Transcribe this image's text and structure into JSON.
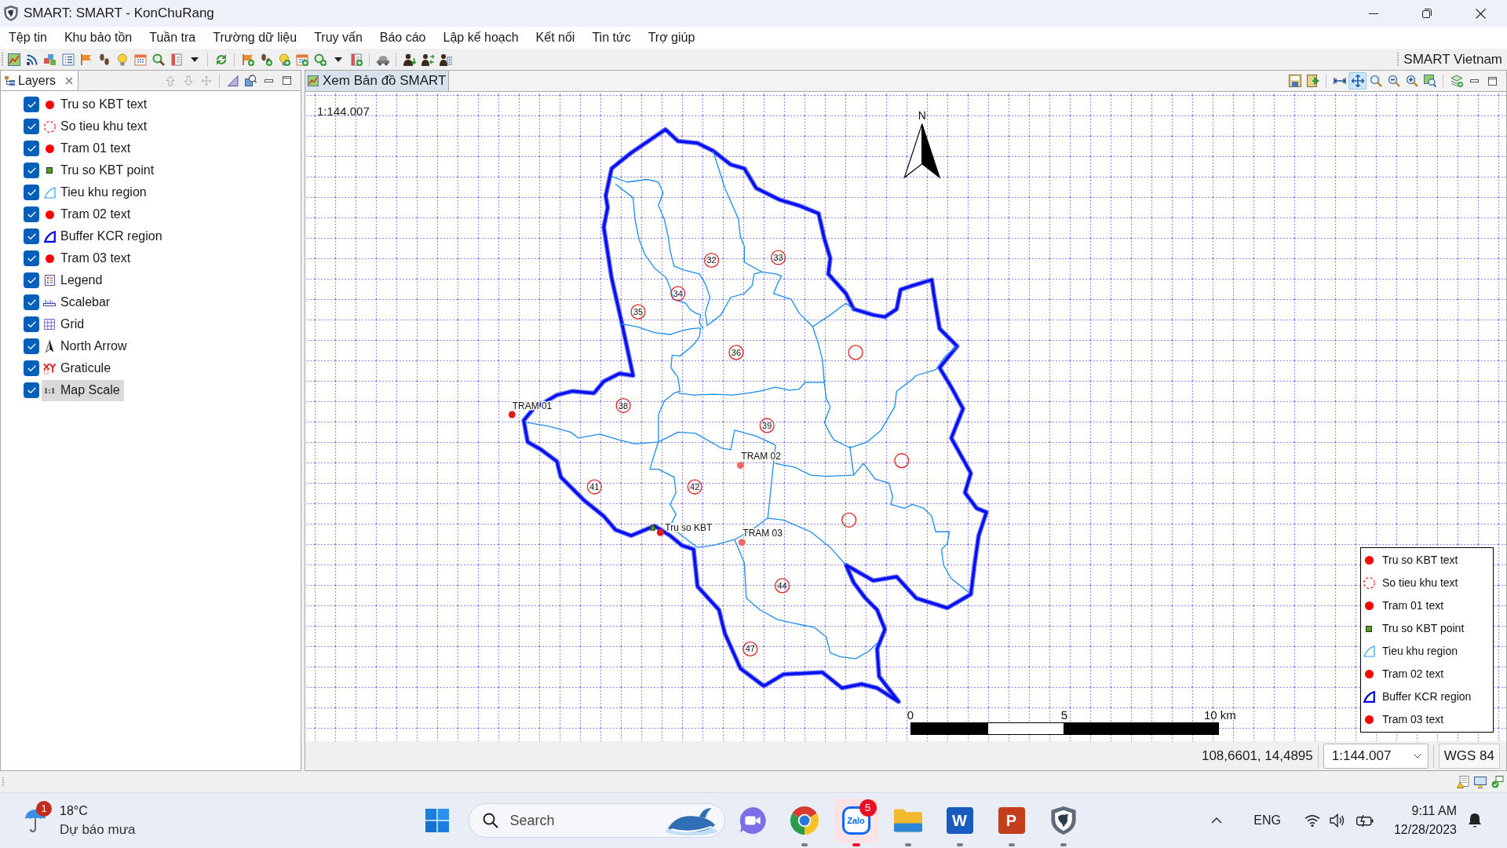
{
  "window": {
    "title": "SMART: SMART - KonChuRang"
  },
  "menu": [
    "Tệp tin",
    "Khu bảo tồn",
    "Tuần tra",
    "Trường dữ liệu",
    "Truy vấn",
    "Báo cáo",
    "Lập kế hoạch",
    "Kết nối",
    "Tin tức",
    "Trợ giúp"
  ],
  "toolbar": {
    "brand": "SMART Vietnam"
  },
  "layers_panel": {
    "title": "Layers",
    "items": [
      {
        "label": "Tru so KBT text",
        "kind": "dot",
        "checked": true,
        "selected": false
      },
      {
        "label": "So tieu khu text",
        "kind": "ring",
        "checked": true,
        "selected": false
      },
      {
        "label": "Tram 01 text",
        "kind": "dot",
        "checked": true,
        "selected": false
      },
      {
        "label": "Tru so KBT point",
        "kind": "square",
        "checked": true,
        "selected": false
      },
      {
        "label": "Tieu khu region",
        "kind": "region",
        "checked": true,
        "selected": false
      },
      {
        "label": "Tram 02 text",
        "kind": "dot",
        "checked": true,
        "selected": false
      },
      {
        "label": "Buffer KCR region",
        "kind": "buffer",
        "checked": true,
        "selected": false
      },
      {
        "label": "Tram 03 text",
        "kind": "dot",
        "checked": true,
        "selected": false
      },
      {
        "label": "Legend",
        "kind": "legend",
        "checked": true,
        "selected": false
      },
      {
        "label": "Scalebar",
        "kind": "scalebar",
        "checked": true,
        "selected": false
      },
      {
        "label": "Grid",
        "kind": "grid",
        "checked": true,
        "selected": false
      },
      {
        "label": "North Arrow",
        "kind": "north",
        "checked": true,
        "selected": false
      },
      {
        "label": "Graticule",
        "kind": "graticule",
        "checked": true,
        "selected": false
      },
      {
        "label": "Map Scale",
        "kind": "scale",
        "icon_text": "1:1",
        "checked": true,
        "selected": true
      }
    ]
  },
  "map_view": {
    "tab": "Xem Bản đồ SMART",
    "tools": [
      {
        "selected": false
      },
      {
        "selected": true
      },
      {
        "selected": false
      },
      {
        "selected": false
      },
      {
        "selected": false
      },
      {
        "selected": false
      }
    ],
    "scale_text": "1:144.007",
    "subzones": [
      "32",
      "33",
      "34",
      "35",
      "36",
      "38",
      "39",
      "41",
      "42",
      "44",
      "47"
    ],
    "points": [
      {
        "label": "TRAM 01",
        "kind": "station",
        "color": "#e31a1c"
      },
      {
        "label": "TRAM 02",
        "kind": "station",
        "color": "#f26666"
      },
      {
        "label": "TRAM 03",
        "kind": "station",
        "color": "#f26666"
      },
      {
        "label": "Tru so KBT",
        "kind": "office",
        "color": "#e31a1c"
      }
    ],
    "north_label": "N",
    "scalebar_labels": [
      "0",
      "5",
      "10 km"
    ],
    "legend": [
      {
        "label": "Tru so KBT text",
        "kind": "dot"
      },
      {
        "label": "So tieu khu text",
        "kind": "ring"
      },
      {
        "label": "Tram 01 text",
        "kind": "dot"
      },
      {
        "label": "Tru so KBT point",
        "kind": "square"
      },
      {
        "label": "Tieu khu region",
        "kind": "region"
      },
      {
        "label": "Tram 02 text",
        "kind": "dot"
      },
      {
        "label": "Buffer KCR region",
        "kind": "buffer"
      },
      {
        "label": "Tram 03 text",
        "kind": "dot"
      }
    ],
    "status": {
      "coordinates": "108,6601, 14,4895",
      "scale": "1:144.007",
      "crs": "WGS 84"
    }
  },
  "taskbar": {
    "weather": {
      "badge": "1",
      "temperature": "18°C",
      "forecast": "Dự báo mưa"
    },
    "search": {
      "placeholder": "Search"
    },
    "apps": [
      {
        "kind": "meet",
        "running": false,
        "selected": false
      },
      {
        "kind": "chrome",
        "running": true,
        "selected": false
      },
      {
        "kind": "zalo",
        "icon_text": "Zalo",
        "badge": "5",
        "running": true,
        "selected": true
      },
      {
        "kind": "explorer",
        "running": true,
        "selected": false
      },
      {
        "kind": "word",
        "icon_text": "W",
        "running": true,
        "selected": false
      },
      {
        "kind": "powerpoint",
        "icon_text": "P",
        "running": true,
        "selected": false
      },
      {
        "kind": "smart",
        "running": true,
        "selected": false
      }
    ],
    "tray": {
      "language": "ENG",
      "time": "9:11 AM",
      "date": "12/28/2023"
    }
  }
}
